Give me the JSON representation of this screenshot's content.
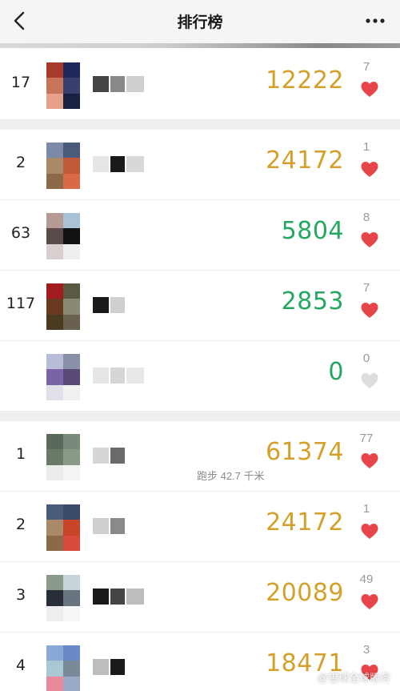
{
  "header": {
    "title": "排行榜"
  },
  "colors": {
    "gold": "#d4a02a",
    "green": "#24a85f",
    "heart_red": "#e8454a",
    "heart_gray": "#dddddd"
  },
  "my_entry": {
    "rank": "17",
    "steps": "12222",
    "likes": "7",
    "liked": true,
    "steps_color": "gold",
    "avatar": [
      "#a83a2c",
      "#1f2a5a",
      "#c8745a",
      "#3a3f6e",
      "#e7a08b",
      "#1a2040"
    ],
    "name_blocks": [
      "#444",
      "#888",
      "#cfcfcf"
    ]
  },
  "compare_list": [
    {
      "rank": "2",
      "steps": "24172",
      "likes": "1",
      "liked": true,
      "steps_color": "gold",
      "avatar": [
        "#7a8aa8",
        "#4a5a7a",
        "#a88a6a",
        "#c25a3a",
        "#8a6a4a",
        "#d86a4a"
      ],
      "name_blocks": [
        "#e6e6e6",
        "#1a1a1a",
        "#d8d8d8"
      ]
    },
    {
      "rank": "63",
      "steps": "5804",
      "likes": "8",
      "liked": true,
      "steps_color": "green",
      "avatar": [
        "#b69a94",
        "#a9c2d6",
        "#5a4a4a",
        "#111111",
        "#d8d0ce",
        "#eeeeee"
      ],
      "name_blocks": []
    },
    {
      "rank": "117",
      "steps": "2853",
      "likes": "7",
      "liked": true,
      "steps_color": "green",
      "avatar": [
        "#a01c20",
        "#5a5a42",
        "#6a3a20",
        "#8a8a74",
        "#4a3a20",
        "#6a6050"
      ],
      "name_blocks": [
        "#1a1a1a",
        "#cfcfcf"
      ]
    },
    {
      "rank": "",
      "steps": "0",
      "likes": "0",
      "liked": false,
      "steps_color": "green",
      "avatar": [
        "#b8bcd6",
        "#8a90a8",
        "#7a64a8",
        "#5a4a7a",
        "#e0e0ea",
        "#f0f0f0"
      ],
      "name_blocks": [
        "#e6e6e6",
        "#d6d6d6",
        "#e8e8e8"
      ]
    }
  ],
  "leaderboard": [
    {
      "rank": "1",
      "steps": "61374",
      "likes": "77",
      "liked": true,
      "steps_color": "gold",
      "activity": "跑步 42.7 千米",
      "avatar": [
        "#5a6a5a",
        "#7a8a7a",
        "#6a7a68",
        "#8a9a88",
        "#ececec",
        "#f4f4f4"
      ],
      "name_blocks": [
        "#d6d6d6",
        "#6a6a6a"
      ]
    },
    {
      "rank": "2",
      "steps": "24172",
      "likes": "1",
      "liked": true,
      "steps_color": "gold",
      "activity": "",
      "avatar": [
        "#4a5a7a",
        "#3a4a6a",
        "#a88a6a",
        "#c8452a",
        "#8a6a4a",
        "#d84a3a"
      ],
      "name_blocks": [
        "#cfcfcf",
        "#8a8a8a"
      ]
    },
    {
      "rank": "3",
      "steps": "20089",
      "likes": "49",
      "liked": true,
      "steps_color": "gold",
      "activity": "",
      "avatar": [
        "#8a9a8a",
        "#c8d4da",
        "#2a2e38",
        "#6a7480",
        "#eeeeee",
        "#f6f6f6"
      ],
      "name_blocks": [
        "#1a1a1a",
        "#444444",
        "#bdbdbd"
      ]
    },
    {
      "rank": "4",
      "steps": "18471",
      "likes": "3",
      "liked": true,
      "steps_color": "gold",
      "activity": "",
      "avatar": [
        "#8aa8d6",
        "#6a8ac6",
        "#a8c8d6",
        "#7a8a98",
        "#e88a9a",
        "#98aac8"
      ],
      "name_blocks": [
        "#bdbdbd",
        "#1a1a1a"
      ]
    }
  ],
  "watermark": "@雪球全球版务"
}
